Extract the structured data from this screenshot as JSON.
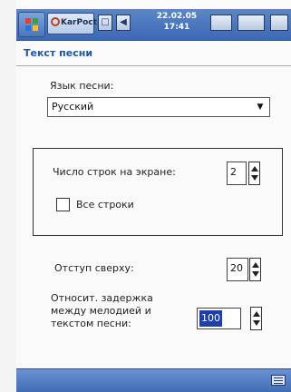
{
  "taskbar": {
    "app_name": "KarPoct",
    "clock_line1": "22.02.05",
    "clock_line2": "17:41"
  },
  "page": {
    "title": "Текст песни"
  },
  "song_language": {
    "label": "Язык песни:",
    "value": "Русский"
  },
  "lines_group": {
    "lines_on_screen_label": "Число строк на экране:",
    "lines_on_screen_value": "2",
    "all_lines_label": "Все строки",
    "all_lines_checked": false
  },
  "top_offset": {
    "label": "Отступ сверху:",
    "value": "20"
  },
  "delay": {
    "label_line1": "Относит. задержка",
    "label_line2": "между мелодией и",
    "label_line3": "текстом песни:",
    "value": "100"
  },
  "colors": {
    "titlebar": "#3d69b3",
    "title_text": "#1f56a8",
    "selection": "#1f3fa8"
  },
  "icons": {
    "start": "windows-flag-icon",
    "keyboard": "keyboard-icon"
  }
}
